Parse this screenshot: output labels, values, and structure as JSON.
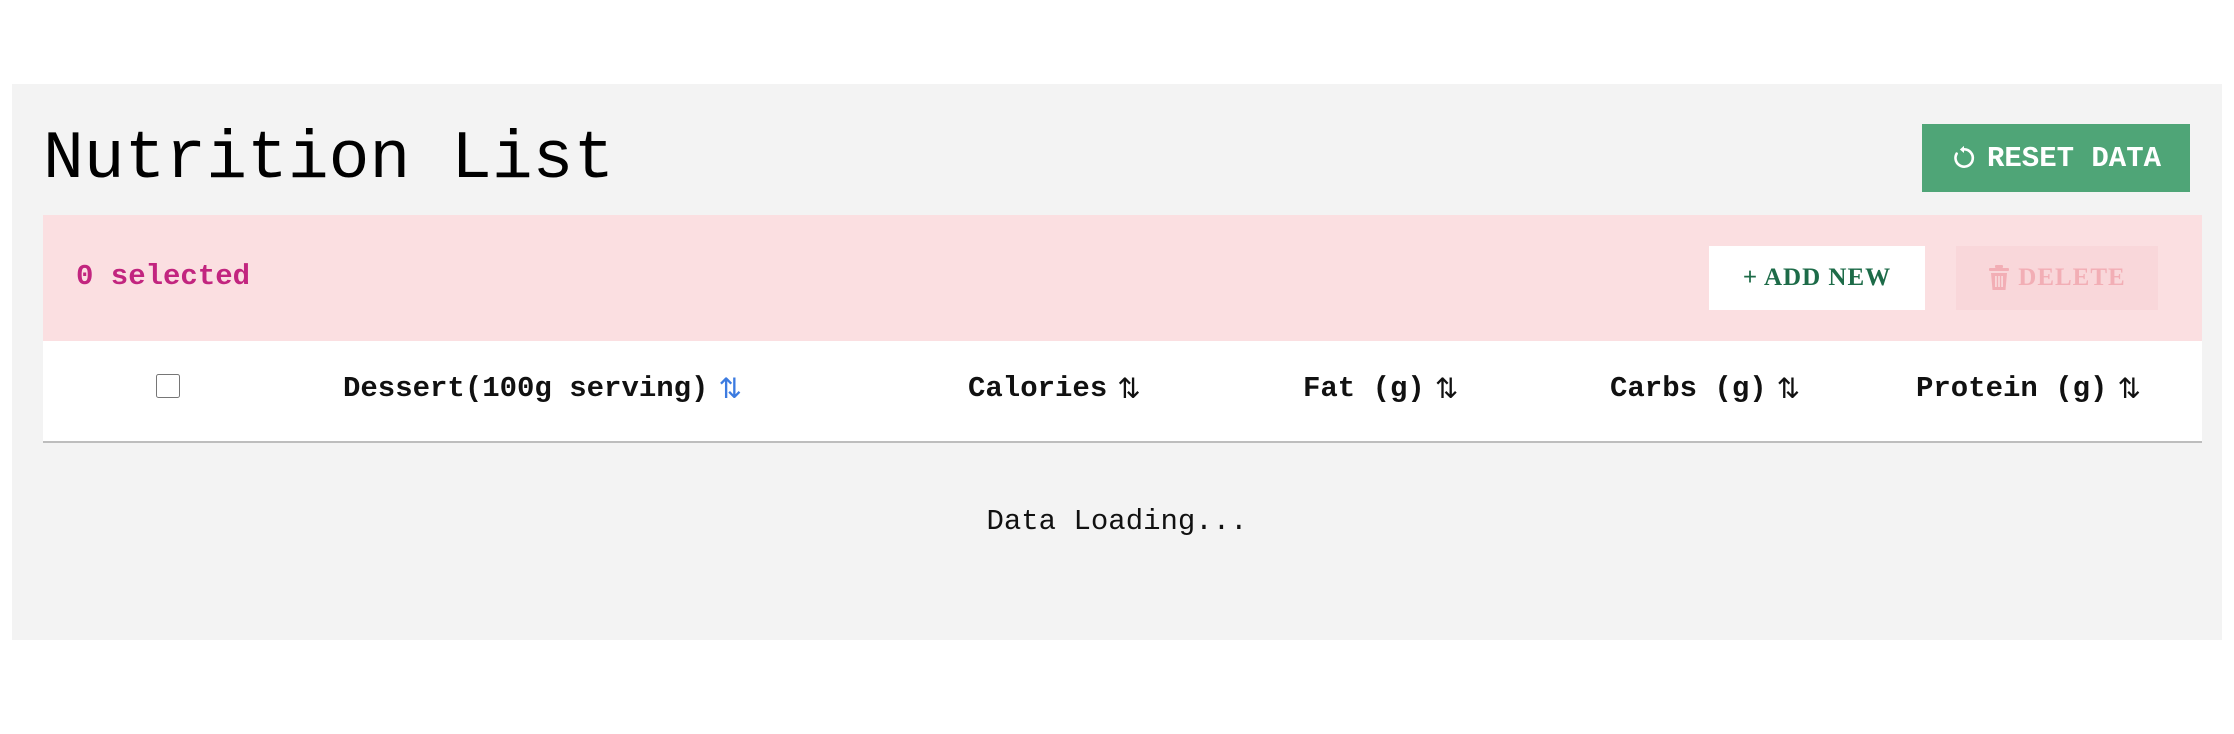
{
  "header": {
    "title": "Nutrition List",
    "reset_label": "RESET DATA",
    "reset_icon": "refresh-icon"
  },
  "toolbar": {
    "selected_text": "0 selected",
    "add_label": "+ ADD NEW",
    "delete_label": "DELETE",
    "delete_icon": "trash-icon",
    "delete_disabled": true
  },
  "table": {
    "columns": [
      {
        "label": "Dessert(100g serving)",
        "sort_icon": "sort-icon",
        "active": true
      },
      {
        "label": "Calories",
        "sort_icon": "sort-icon",
        "active": false
      },
      {
        "label": "Fat (g)",
        "sort_icon": "sort-icon",
        "active": false
      },
      {
        "label": "Carbs (g)",
        "sort_icon": "sort-icon",
        "active": false
      },
      {
        "label": "Protein (g)",
        "sort_icon": "sort-icon",
        "active": false
      }
    ],
    "select_all_checked": false,
    "status_text": "Data Loading..."
  },
  "colors": {
    "panel_bg": "#f3f3f3",
    "reset_button": "#4fa577",
    "toolbar_bg": "#fbdfe1",
    "selected_text": "#c2257f",
    "add_text": "#1d6b48",
    "delete_disabled_text": "#f2aeb5",
    "active_sort": "#3c7be0"
  }
}
